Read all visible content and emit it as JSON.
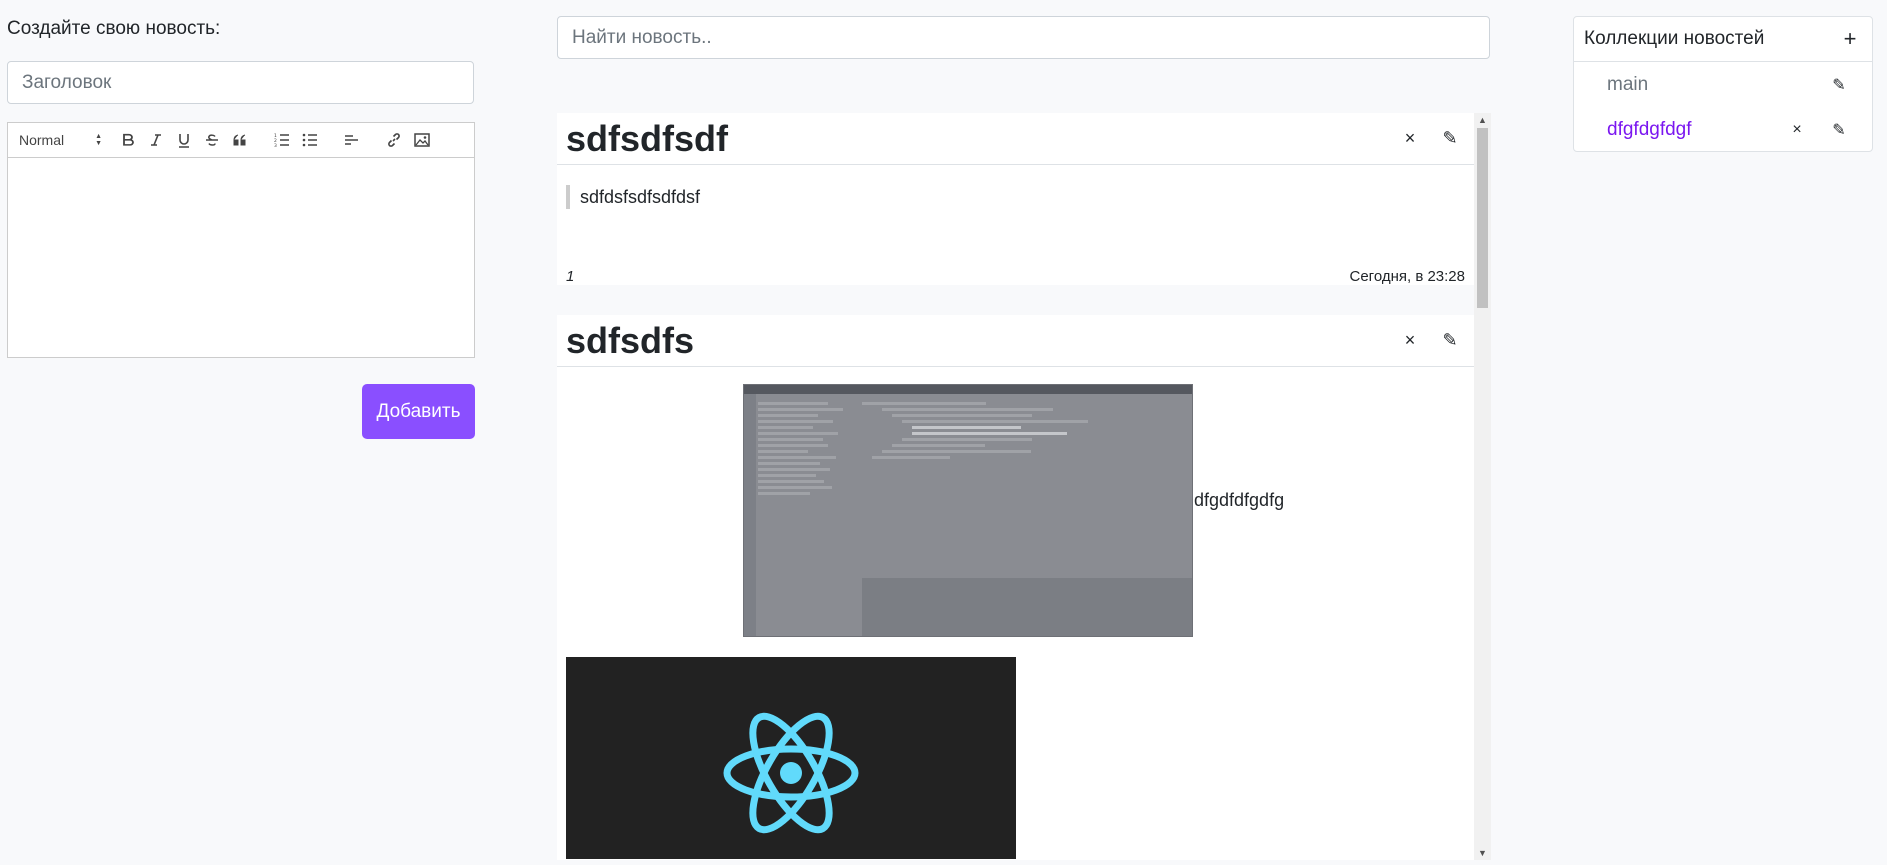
{
  "create": {
    "label": "Создайте свою новость:",
    "title_placeholder": "Заголовок",
    "format_select": "Normal",
    "add_button": "Добавить"
  },
  "search": {
    "placeholder": "Найти новость.."
  },
  "feed": [
    {
      "title": "sdfsdfsdf",
      "quote": "sdfdsfsdfsdfdsf",
      "footer_left": "1",
      "footer_right": "Сегодня, в 23:28",
      "delete_icon": "×",
      "edit_icon": "✎"
    },
    {
      "title": "sdfsdfs",
      "after_image_text": "dfgdfdfgdfg",
      "delete_icon": "×",
      "edit_icon": "✎"
    }
  ],
  "collections": {
    "title": "Коллекции новостей",
    "add_icon": "+",
    "items": [
      {
        "name": "main",
        "active": false,
        "edit_icon": "✎"
      },
      {
        "name": "dfgfdgfdgf",
        "active": true,
        "delete_icon": "×",
        "edit_icon": "✎"
      }
    ]
  },
  "colors": {
    "accent": "#8a4fff",
    "active_link": "#7a16f0",
    "react_blue": "#61dafb"
  }
}
